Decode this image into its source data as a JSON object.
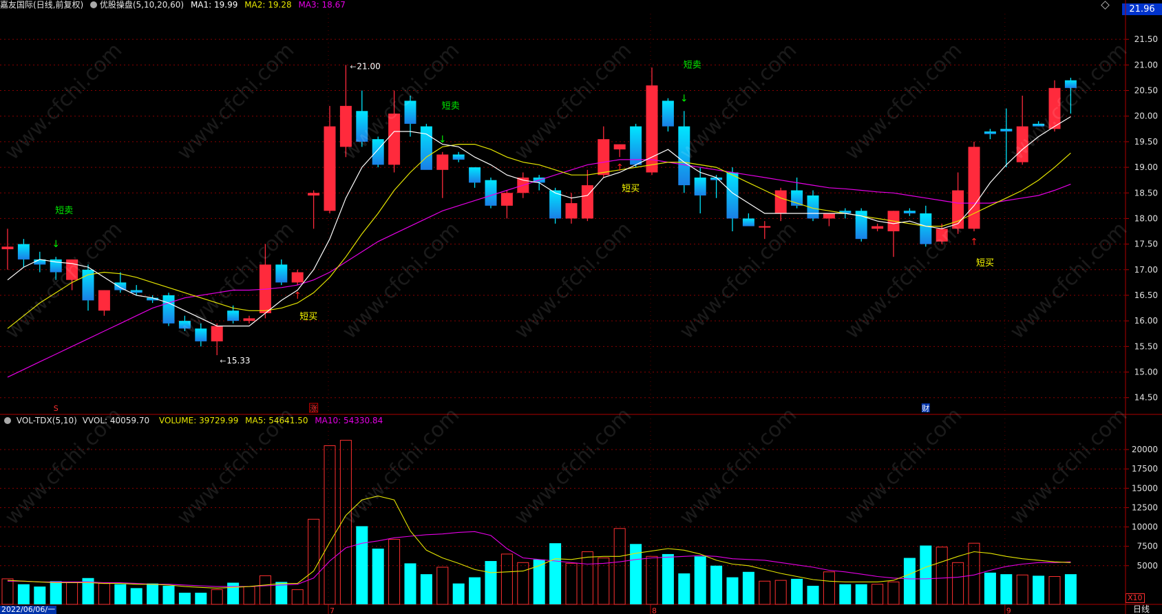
{
  "header": {
    "name": "嘉友国际",
    "mode": "(日线,前复权)",
    "indicator": "优股操盘(5,10,20,60)",
    "ma1_label": "MA1: 19.99",
    "ma2_label": "MA2: 19.28",
    "ma3_label": "MA3: 18.67",
    "price_tag": "21.96"
  },
  "vol_header": {
    "name": "VOL-TDX(5,10)",
    "vvol": "VVOL: 40059.70",
    "volume": "VOLUME: 39729.99",
    "ma5": "MA5: 54641.50",
    "ma10": "MA10: 54330.84"
  },
  "bottom": {
    "date_label": "2022/06/06/一",
    "month_7": "7",
    "month_8": "8",
    "month_9": "9",
    "period": "日线",
    "vol_unit": "X10"
  },
  "event_markers": {
    "s": "S",
    "zhang": "涨",
    "cai": "财"
  },
  "watermark": "www.cfchi.com",
  "colors": {
    "up": "#ff2a3c",
    "down_top": "#00e6ff",
    "down_bottom": "#1a7fe6",
    "ma1": "#ffffff",
    "ma2": "#e6e600",
    "ma3": "#e600e6",
    "vol_down": "#00ffff",
    "vol_up_border": "#ff3030",
    "sell_signal": "#00ee00",
    "buy_signal": "#ffff00",
    "grid": "#8b0000"
  },
  "chart_data": {
    "type": "candlestick",
    "price_axis": {
      "ticks": [
        "21.50",
        "21.00",
        "20.50",
        "20.00",
        "19.50",
        "19.00",
        "18.50",
        "18.00",
        "17.50",
        "17.00",
        "16.50",
        "16.00",
        "15.50",
        "15.00",
        "14.50"
      ],
      "ylim": [
        14.2,
        22.0
      ]
    },
    "volume_axis": {
      "ticks": [
        "20000",
        "17500",
        "15000",
        "12500",
        "10000",
        "7500",
        "5000"
      ],
      "ylim": [
        0,
        22500
      ]
    },
    "candles": [
      {
        "o": 17.4,
        "h": 17.8,
        "l": 17.0,
        "c": 17.45
      },
      {
        "o": 17.5,
        "h": 17.6,
        "l": 17.05,
        "c": 17.2
      },
      {
        "o": 17.2,
        "h": 17.35,
        "l": 16.95,
        "c": 17.1
      },
      {
        "o": 17.2,
        "h": 17.25,
        "l": 16.8,
        "c": 16.95
      },
      {
        "o": 16.8,
        "h": 17.2,
        "l": 16.6,
        "c": 17.2
      },
      {
        "o": 17.0,
        "h": 17.1,
        "l": 16.2,
        "c": 16.4
      },
      {
        "o": 16.2,
        "h": 16.6,
        "l": 16.1,
        "c": 16.6
      },
      {
        "o": 16.75,
        "h": 16.95,
        "l": 16.55,
        "c": 16.6
      },
      {
        "o": 16.6,
        "h": 16.7,
        "l": 16.5,
        "c": 16.55
      },
      {
        "o": 16.45,
        "h": 16.5,
        "l": 16.35,
        "c": 16.4
      },
      {
        "o": 16.5,
        "h": 16.55,
        "l": 15.9,
        "c": 15.95
      },
      {
        "o": 16.0,
        "h": 16.1,
        "l": 15.8,
        "c": 15.85
      },
      {
        "o": 15.85,
        "h": 15.95,
        "l": 15.5,
        "c": 15.6
      },
      {
        "o": 15.6,
        "h": 15.95,
        "l": 15.33,
        "c": 15.9
      },
      {
        "o": 16.2,
        "h": 16.3,
        "l": 15.95,
        "c": 16.0
      },
      {
        "o": 16.0,
        "h": 16.1,
        "l": 15.95,
        "c": 16.05
      },
      {
        "o": 16.15,
        "h": 17.5,
        "l": 16.05,
        "c": 17.1
      },
      {
        "o": 17.1,
        "h": 17.2,
        "l": 16.7,
        "c": 16.75
      },
      {
        "o": 16.75,
        "h": 17.0,
        "l": 16.7,
        "c": 16.95
      },
      {
        "o": 18.45,
        "h": 18.55,
        "l": 17.8,
        "c": 18.5
      },
      {
        "o": 18.15,
        "h": 20.2,
        "l": 18.1,
        "c": 19.8
      },
      {
        "o": 19.4,
        "h": 21.0,
        "l": 19.2,
        "c": 20.2
      },
      {
        "o": 20.1,
        "h": 20.5,
        "l": 19.4,
        "c": 19.5
      },
      {
        "o": 19.55,
        "h": 19.6,
        "l": 19.0,
        "c": 19.05
      },
      {
        "o": 19.05,
        "h": 20.5,
        "l": 18.9,
        "c": 20.05
      },
      {
        "o": 20.3,
        "h": 20.4,
        "l": 19.6,
        "c": 19.85
      },
      {
        "o": 19.8,
        "h": 19.85,
        "l": 19.0,
        "c": 18.95
      },
      {
        "o": 18.95,
        "h": 19.3,
        "l": 18.4,
        "c": 19.25
      },
      {
        "o": 19.25,
        "h": 19.3,
        "l": 19.1,
        "c": 19.15
      },
      {
        "o": 19.0,
        "h": 19.0,
        "l": 18.6,
        "c": 18.7
      },
      {
        "o": 18.75,
        "h": 18.8,
        "l": 18.2,
        "c": 18.25
      },
      {
        "o": 18.25,
        "h": 18.55,
        "l": 18.0,
        "c": 18.5
      },
      {
        "o": 18.5,
        "h": 18.9,
        "l": 18.4,
        "c": 18.8
      },
      {
        "o": 18.8,
        "h": 18.85,
        "l": 18.55,
        "c": 18.7
      },
      {
        "o": 18.55,
        "h": 18.6,
        "l": 17.9,
        "c": 18.0
      },
      {
        "o": 18.0,
        "h": 18.5,
        "l": 17.9,
        "c": 18.3
      },
      {
        "o": 18.0,
        "h": 18.95,
        "l": 17.95,
        "c": 18.65
      },
      {
        "o": 18.85,
        "h": 19.8,
        "l": 18.8,
        "c": 19.55
      },
      {
        "o": 19.35,
        "h": 19.45,
        "l": 19.2,
        "c": 19.45
      },
      {
        "o": 19.8,
        "h": 19.85,
        "l": 19.0,
        "c": 19.05
      },
      {
        "o": 18.9,
        "h": 20.95,
        "l": 18.85,
        "c": 20.6
      },
      {
        "o": 20.3,
        "h": 20.35,
        "l": 19.7,
        "c": 19.8
      },
      {
        "o": 19.8,
        "h": 20.1,
        "l": 18.5,
        "c": 18.65
      },
      {
        "o": 18.8,
        "h": 19.0,
        "l": 18.1,
        "c": 18.45
      },
      {
        "o": 18.8,
        "h": 18.85,
        "l": 18.4,
        "c": 18.75
      },
      {
        "o": 18.9,
        "h": 19.0,
        "l": 17.75,
        "c": 18.0
      },
      {
        "o": 18.0,
        "h": 18.1,
        "l": 17.9,
        "c": 17.85
      },
      {
        "o": 17.85,
        "h": 17.95,
        "l": 17.6,
        "c": 17.85
      },
      {
        "o": 18.1,
        "h": 18.6,
        "l": 17.95,
        "c": 18.55
      },
      {
        "o": 18.55,
        "h": 18.8,
        "l": 18.2,
        "c": 18.25
      },
      {
        "o": 18.45,
        "h": 18.55,
        "l": 17.95,
        "c": 18.0
      },
      {
        "o": 18.0,
        "h": 18.1,
        "l": 17.85,
        "c": 18.1
      },
      {
        "o": 18.15,
        "h": 18.2,
        "l": 18.0,
        "c": 18.1
      },
      {
        "o": 18.15,
        "h": 18.2,
        "l": 17.55,
        "c": 17.6
      },
      {
        "o": 17.8,
        "h": 17.9,
        "l": 17.75,
        "c": 17.85
      },
      {
        "o": 17.75,
        "h": 18.15,
        "l": 17.25,
        "c": 18.15
      },
      {
        "o": 18.15,
        "h": 18.2,
        "l": 18.05,
        "c": 18.1
      },
      {
        "o": 18.1,
        "h": 18.25,
        "l": 17.45,
        "c": 17.5
      },
      {
        "o": 17.55,
        "h": 17.9,
        "l": 17.5,
        "c": 17.8
      },
      {
        "o": 17.8,
        "h": 18.9,
        "l": 17.7,
        "c": 18.55
      },
      {
        "o": 17.8,
        "h": 19.5,
        "l": 17.75,
        "c": 19.4
      },
      {
        "o": 19.7,
        "h": 19.75,
        "l": 19.55,
        "c": 19.65
      },
      {
        "o": 19.75,
        "h": 20.15,
        "l": 19.0,
        "c": 19.7
      },
      {
        "o": 19.1,
        "h": 20.4,
        "l": 19.05,
        "c": 19.8
      },
      {
        "o": 19.85,
        "h": 19.9,
        "l": 19.8,
        "c": 19.8
      },
      {
        "o": 19.75,
        "h": 20.7,
        "l": 19.7,
        "c": 20.55
      },
      {
        "o": 20.7,
        "h": 20.75,
        "l": 20.05,
        "c": 20.55
      }
    ],
    "ma1": [
      16.8,
      17.05,
      17.2,
      17.15,
      17.12,
      17.05,
      16.85,
      16.65,
      16.5,
      16.45,
      16.35,
      16.2,
      16.05,
      15.9,
      15.9,
      15.9,
      16.15,
      16.4,
      16.6,
      17.0,
      17.6,
      18.4,
      19.0,
      19.35,
      19.7,
      19.7,
      19.65,
      19.45,
      19.4,
      19.2,
      19.05,
      18.85,
      18.75,
      18.7,
      18.5,
      18.4,
      18.45,
      18.8,
      18.9,
      19.05,
      19.2,
      19.35,
      19.1,
      18.9,
      18.8,
      18.5,
      18.3,
      18.1,
      18.1,
      18.1,
      18.1,
      18.1,
      18.1,
      18.05,
      17.95,
      17.9,
      17.95,
      17.85,
      17.8,
      17.9,
      18.25,
      18.7,
      19.05,
      19.35,
      19.6,
      19.8,
      19.99
    ],
    "ma2": [
      15.85,
      16.1,
      16.35,
      16.55,
      16.75,
      16.9,
      16.95,
      16.92,
      16.85,
      16.75,
      16.65,
      16.55,
      16.45,
      16.35,
      16.25,
      16.2,
      16.2,
      16.25,
      16.35,
      16.55,
      16.85,
      17.25,
      17.7,
      18.1,
      18.55,
      18.9,
      19.2,
      19.4,
      19.45,
      19.45,
      19.35,
      19.2,
      19.1,
      19.05,
      18.95,
      18.85,
      18.85,
      18.9,
      18.95,
      19.0,
      19.05,
      19.1,
      19.1,
      19.05,
      19.0,
      18.85,
      18.7,
      18.55,
      18.4,
      18.3,
      18.2,
      18.15,
      18.1,
      18.05,
      18.0,
      17.95,
      17.9,
      17.85,
      17.85,
      17.95,
      18.1,
      18.25,
      18.4,
      18.55,
      18.75,
      19.0,
      19.28
    ],
    "ma3": [
      14.9,
      15.05,
      15.2,
      15.35,
      15.5,
      15.65,
      15.8,
      15.95,
      16.1,
      16.25,
      16.35,
      16.45,
      16.5,
      16.55,
      16.6,
      16.6,
      16.62,
      16.65,
      16.7,
      16.8,
      16.95,
      17.15,
      17.35,
      17.55,
      17.7,
      17.85,
      18.0,
      18.15,
      18.25,
      18.35,
      18.45,
      18.55,
      18.65,
      18.75,
      18.85,
      18.95,
      19.05,
      19.1,
      19.15,
      19.15,
      19.15,
      19.1,
      19.05,
      19.0,
      18.95,
      18.9,
      18.85,
      18.8,
      18.75,
      18.7,
      18.65,
      18.6,
      18.58,
      18.55,
      18.52,
      18.5,
      18.45,
      18.4,
      18.35,
      18.3,
      18.3,
      18.3,
      18.35,
      18.4,
      18.45,
      18.55,
      18.67
    ],
    "volumes": [
      3300,
      2600,
      2300,
      3000,
      2800,
      3400,
      2700,
      2600,
      2100,
      2700,
      2400,
      1500,
      1500,
      1900,
      2800,
      2300,
      3700,
      2900,
      1900,
      11000,
      20500,
      21200,
      10100,
      7200,
      8400,
      5300,
      3900,
      4800,
      2700,
      3500,
      5600,
      6500,
      5400,
      5800,
      7900,
      5300,
      6800,
      6000,
      9800,
      7800,
      6200,
      6500,
      4000,
      6200,
      5000,
      3500,
      4200,
      3000,
      3100,
      3300,
      2400,
      4200,
      2600,
      2600,
      2600,
      2900,
      6000,
      7600,
      7400,
      5400,
      7900,
      4100,
      3900,
      3800,
      3700,
      3600,
      3900
    ],
    "vol_ma5": [
      3100,
      3000,
      2900,
      2800,
      2800,
      2800,
      2700,
      2700,
      2600,
      2600,
      2500,
      2300,
      2200,
      2100,
      2200,
      2300,
      2500,
      2700,
      2700,
      4300,
      8000,
      11500,
      13500,
      14000,
      13500,
      9500,
      7000,
      6000,
      5300,
      4500,
      4100,
      4200,
      4300,
      5000,
      5900,
      5800,
      6100,
      6200,
      6200,
      6600,
      6900,
      7200,
      7000,
      6500,
      5700,
      5200,
      5000,
      4500,
      4000,
      3600,
      3200,
      3000,
      2900,
      2900,
      2900,
      3100,
      3900,
      4800,
      5500,
      6200,
      6800,
      6600,
      6200,
      5900,
      5700,
      5500,
      5400
    ],
    "vol_ma10": [
      3000,
      3000,
      2900,
      2900,
      2900,
      2900,
      2800,
      2800,
      2700,
      2600,
      2600,
      2500,
      2400,
      2300,
      2300,
      2300,
      2400,
      2500,
      2600,
      3400,
      5600,
      7300,
      7900,
      8200,
      8600,
      8800,
      9000,
      9100,
      9300,
      9400,
      8900,
      7200,
      6000,
      5800,
      5600,
      5400,
      5200,
      5300,
      5500,
      5800,
      6000,
      6100,
      6200,
      6300,
      6200,
      5900,
      5800,
      5700,
      5400,
      5100,
      4800,
      4400,
      4200,
      3900,
      3600,
      3400,
      3300,
      3300,
      3400,
      3500,
      3800,
      4400,
      4900,
      5200,
      5400,
      5400,
      5500
    ]
  },
  "annotations": {
    "max_label": "21.00",
    "min_label": "15.33",
    "signals": [
      {
        "bar": 3,
        "kind": "sell",
        "text": "短卖"
      },
      {
        "bar": 18,
        "kind": "buy",
        "text": "短买"
      },
      {
        "bar": 27,
        "kind": "sell",
        "text": "短卖"
      },
      {
        "bar": 38,
        "kind": "buy",
        "text": "短买"
      },
      {
        "bar": 42,
        "kind": "sell",
        "text": "短卖"
      },
      {
        "bar": 60,
        "kind": "buy",
        "text": "短买"
      }
    ]
  }
}
